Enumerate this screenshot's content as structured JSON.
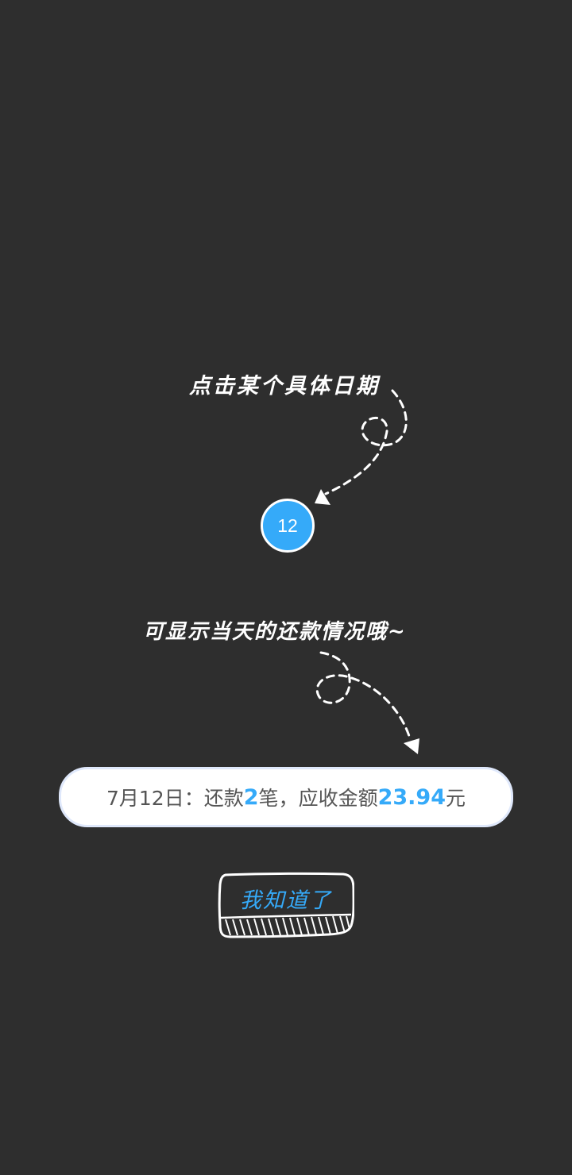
{
  "guide": {
    "hint_tap_date": "点击某个具体日期",
    "date_badge": "12",
    "hint_show_repayment": "可显示当天的还款情况哦~"
  },
  "summary": {
    "date": "7月12日",
    "separator": "：",
    "prefix": "还款",
    "count": "2",
    "count_unit": "笔",
    "comma": "，",
    "amount_label": "应收金额",
    "amount": "23.94",
    "amount_unit": "元"
  },
  "actions": {
    "dismiss_label": "我知道了"
  },
  "colors": {
    "background": "#2e2e2e",
    "accent": "#35aaf9",
    "text_muted": "#555555"
  },
  "icons": {
    "arrow_top": "dashed-curly-arrow-icon",
    "arrow_bottom": "dashed-curly-arrow-icon"
  }
}
